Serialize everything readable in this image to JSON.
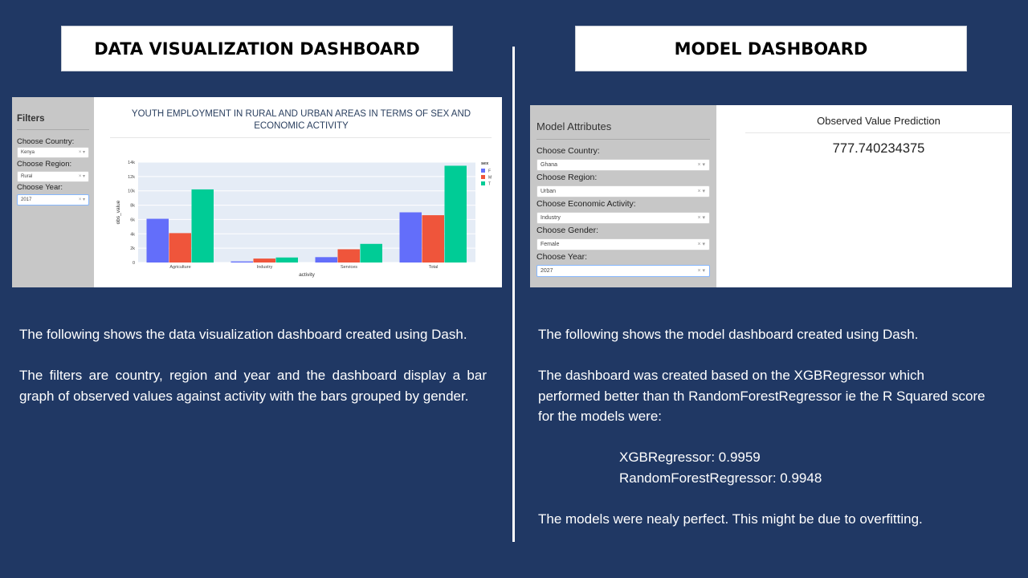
{
  "left": {
    "title": "DATA VISUALIZATION DASHBOARD",
    "screenshot": {
      "sidebar_title": "Filters",
      "filters": [
        {
          "label": "Choose Country:",
          "value": "Kenya"
        },
        {
          "label": "Choose Region:",
          "value": "Rural"
        },
        {
          "label": "Choose Year:",
          "value": "2017"
        }
      ],
      "select_arrows": "× ▾"
    },
    "paragraphs": [
      "The following shows the data visualization dashboard created using Dash.",
      "The filters are country, region and year and the dashboard display a bar graph of observed values against activity with the bars grouped by gender."
    ]
  },
  "right": {
    "title": "MODEL DASHBOARD",
    "screenshot": {
      "sidebar_title": "Model Attributes",
      "attributes": [
        {
          "label": "Choose Country:",
          "value": "Ghana"
        },
        {
          "label": "Choose Region:",
          "value": "Urban"
        },
        {
          "label": "Choose Economic Activity:",
          "value": "Industry"
        },
        {
          "label": "Choose Gender:",
          "value": "Female"
        },
        {
          "label": "Choose Year:",
          "value": "2027"
        }
      ],
      "select_arrows": "× ▾",
      "prediction_title": "Observed Value Prediction",
      "prediction_value": "777.740234375"
    },
    "paragraphs": [
      "The following shows the model dashboard created using Dash.",
      "The dashboard was created based on the XGBRegressor  which performed better than th RandomForestRegressor  ie the R Squared score for the models were:"
    ],
    "scores": [
      "XGBRegressor:  0.9959",
      "RandomForestRegressor:  0.9948"
    ],
    "closing": "The models were nealy perfect. This might be due to overfitting."
  },
  "chart_data": {
    "type": "bar",
    "title": "YOUTH EMPLOYMENT IN RURAL AND URBAN AREAS IN TERMS OF SEX AND ECONOMIC ACTIVITY",
    "xlabel": "activity",
    "ylabel": "obs_value",
    "categories": [
      "Agriculture",
      "Industry",
      "Services",
      "Total"
    ],
    "series": [
      {
        "name": "F",
        "color": "#636efa",
        "values": [
          6100,
          150,
          750,
          7000
        ]
      },
      {
        "name": "M",
        "color": "#ef553b",
        "values": [
          4100,
          550,
          1850,
          6600
        ]
      },
      {
        "name": "T",
        "color": "#00cc96",
        "values": [
          10200,
          700,
          2600,
          13500
        ]
      }
    ],
    "ylim": [
      0,
      14000
    ],
    "yticks": [
      0,
      2000,
      4000,
      6000,
      8000,
      10000,
      12000,
      14000
    ],
    "ytick_labels": [
      "0",
      "2k",
      "4k",
      "6k",
      "8k",
      "10k",
      "12k",
      "14k"
    ],
    "legend_title": "sex",
    "legend_position": "top-right",
    "grid": true,
    "plot_bg": "#e5ecf6"
  }
}
